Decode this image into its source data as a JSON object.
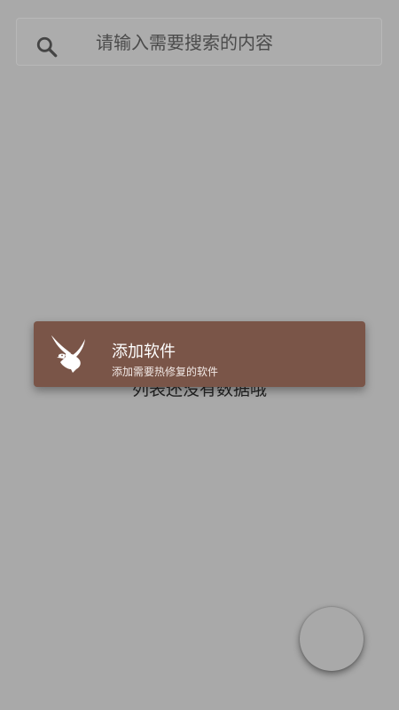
{
  "search": {
    "placeholder": "请输入需要搜索的内容",
    "icon": "search-icon"
  },
  "empty_state": {
    "text": "列表还没有数据哦"
  },
  "toast": {
    "title": "添加软件",
    "subtitle": "添加需要热修复的软件",
    "icon": "eagle-icon",
    "background": "#7a5548"
  },
  "colors": {
    "overlay": "#a9a9a9",
    "toast": "#7a5548"
  }
}
